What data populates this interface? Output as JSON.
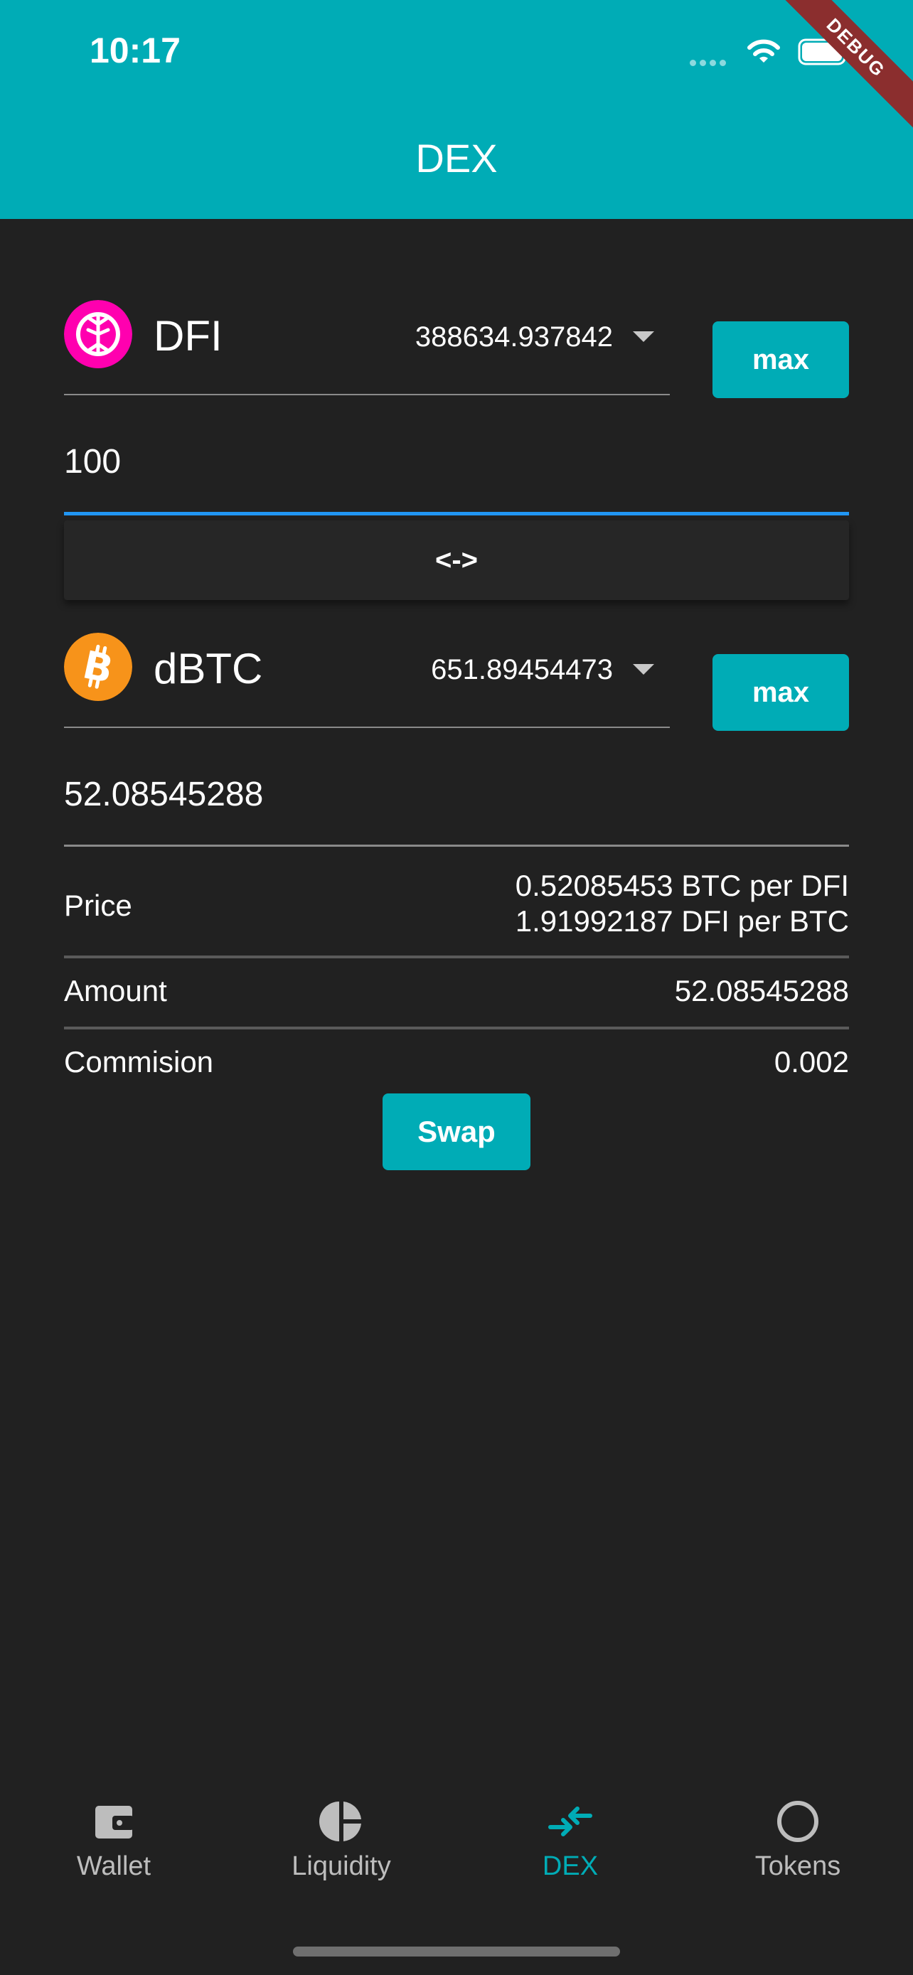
{
  "status_bar": {
    "time": "10:17"
  },
  "debug_banner": "DEBUG",
  "app_bar": {
    "title": "DEX"
  },
  "from": {
    "token": "DFI",
    "balance": "388634.937842",
    "max_label": "max",
    "amount": "100",
    "icon": "defichain-icon",
    "icon_color": "#ff00af"
  },
  "swap_direction_label": "<->",
  "to": {
    "token": "dBTC",
    "balance": "651.89454473",
    "max_label": "max",
    "amount": "52.08545288",
    "icon": "bitcoin-icon",
    "icon_color": "#f7931a"
  },
  "info": {
    "price_label": "Price",
    "price_value_1": "0.52085453 BTC per DFI",
    "price_value_2": "1.91992187 DFI per BTC",
    "amount_label": "Amount",
    "amount_value": "52.08545288",
    "commission_label": "Commision",
    "commission_value": "0.002"
  },
  "swap_button": "Swap",
  "bottom_nav": [
    {
      "label": "Wallet",
      "icon": "wallet-icon",
      "active": false
    },
    {
      "label": "Liquidity",
      "icon": "pie-chart-icon",
      "active": false
    },
    {
      "label": "DEX",
      "icon": "swap-arrows-icon",
      "active": true
    },
    {
      "label": "Tokens",
      "icon": "circle-icon",
      "active": false
    }
  ],
  "colors": {
    "accent": "#00acb6",
    "background": "#212121",
    "input_focus": "#2196f3"
  }
}
